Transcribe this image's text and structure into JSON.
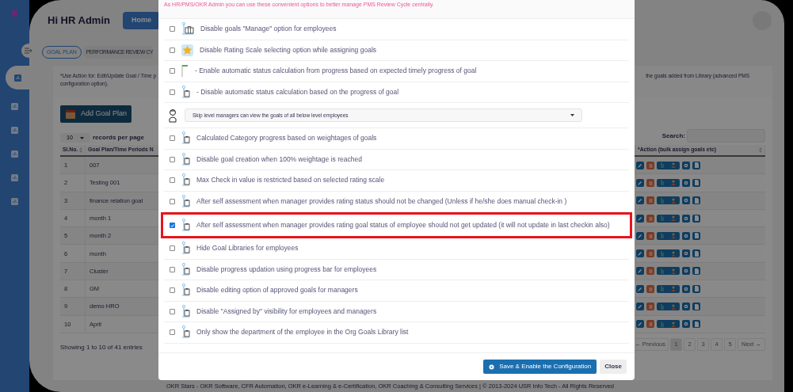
{
  "sidebar": {
    "items": [
      {
        "selected": true
      },
      {
        "selected": false
      },
      {
        "selected": false
      },
      {
        "selected": false
      },
      {
        "selected": false
      },
      {
        "selected": false
      }
    ]
  },
  "header": {
    "greeting": "Hi HR Admin",
    "home_button": "Home"
  },
  "tabs": [
    {
      "label": "GOAL PLAN",
      "selected": true
    },
    {
      "label": "PERFORMANCE REVIEW CY",
      "selected": false
    }
  ],
  "info_note": {
    "left_lines": [
      "*Use Action for: Edit/Update Goal / Time p",
      "configuration option)."
    ],
    "right_text": "the goals added from Library (advanced PMS"
  },
  "add_button": "Add Goal Plan",
  "page_size": {
    "value": "10",
    "label": "records per page"
  },
  "search": {
    "label": "Search:"
  },
  "table": {
    "columns": [
      "Sl.No.",
      "Goal Plan/Time Periods N",
      "*Action (bulk assign goals etc)"
    ],
    "rows": [
      {
        "sl": "1",
        "name": "007"
      },
      {
        "sl": "2",
        "name": "Testing 001"
      },
      {
        "sl": "3",
        "name": "finance relation goal"
      },
      {
        "sl": "4",
        "name": "month 1"
      },
      {
        "sl": "5",
        "name": "month 2"
      },
      {
        "sl": "6",
        "name": "month"
      },
      {
        "sl": "7",
        "name": "Cluster"
      },
      {
        "sl": "8",
        "name": "GM"
      },
      {
        "sl": "9",
        "name": "demo HRO"
      },
      {
        "sl": "10",
        "name": "April"
      }
    ]
  },
  "entries_info": "Showing 1 to 10 of 41 entries",
  "pagination": {
    "previous": "← Previous",
    "pages": [
      {
        "label": "1",
        "selected": true
      },
      {
        "label": "2",
        "selected": false
      },
      {
        "label": "3",
        "selected": false
      },
      {
        "label": "4",
        "selected": false
      },
      {
        "label": "5",
        "selected": false
      }
    ],
    "next": "Next →"
  },
  "modal": {
    "intro": "As HR/PMS/OKR Admin you can use these convenient options to better manage PMS Review Cycle centrally.",
    "options": [
      {
        "kind": "checkbox",
        "label": "Disable goals \"Manage\" option for employees",
        "checked": false,
        "highlighted": false
      },
      {
        "kind": "checkbox",
        "label": "Disable Rating Scale selecting option while assigning goals",
        "checked": false,
        "highlighted": false
      },
      {
        "kind": "checkbox",
        "label": "- Enable automatic status calculation from progress based on expected timely progress of goal",
        "checked": false,
        "highlighted": false
      },
      {
        "kind": "checkbox",
        "label": "- Disable automatic status calculation based on the progress of goal",
        "checked": false,
        "highlighted": false
      },
      {
        "kind": "select",
        "value": "Skip level managers can view the goals of all below level employees"
      },
      {
        "kind": "checkbox",
        "label": "Calculated Category progress based on weightages of goals",
        "checked": false,
        "highlighted": false
      },
      {
        "kind": "checkbox",
        "label": "Disable goal creation when 100% weightage is reached",
        "checked": false,
        "highlighted": false
      },
      {
        "kind": "checkbox",
        "label": "Max Check in value is restricted based on selected rating scale",
        "checked": false,
        "highlighted": false
      },
      {
        "kind": "checkbox",
        "label": "After self assessment when manager provides rating status should not be changed (Unless if he/she does manual check-in )",
        "checked": false,
        "highlighted": false
      },
      {
        "kind": "checkbox",
        "label": "After self assessment when manager provides rating goal status of employee should not get updated (it will not update in last checkin also)",
        "checked": true,
        "highlighted": true
      },
      {
        "kind": "checkbox",
        "label": "Hide Goal Libraries for employees",
        "checked": false,
        "highlighted": false
      },
      {
        "kind": "checkbox",
        "label": "Disable progress updation using progress bar for employees",
        "checked": false,
        "highlighted": false
      },
      {
        "kind": "checkbox",
        "label": "Disable editing option of approved goals for managers",
        "checked": false,
        "highlighted": false
      },
      {
        "kind": "checkbox",
        "label": "Disable \"Assigned by\" visibility for employees and managers",
        "checked": false,
        "highlighted": false
      },
      {
        "kind": "checkbox",
        "label": "Only show the department of the employee in the Org Goals Library list",
        "checked": false,
        "highlighted": false
      }
    ],
    "save_button": "Save & Enable the Configuration",
    "close_button": "Close"
  },
  "footer": "OKR Stars - OKR Software, CFR Automation, OKR e-Learning & e-Certification, OKR Coaching & Consulting Services | © 2013-2024 USR Info Tech - All Rights Reserved"
}
